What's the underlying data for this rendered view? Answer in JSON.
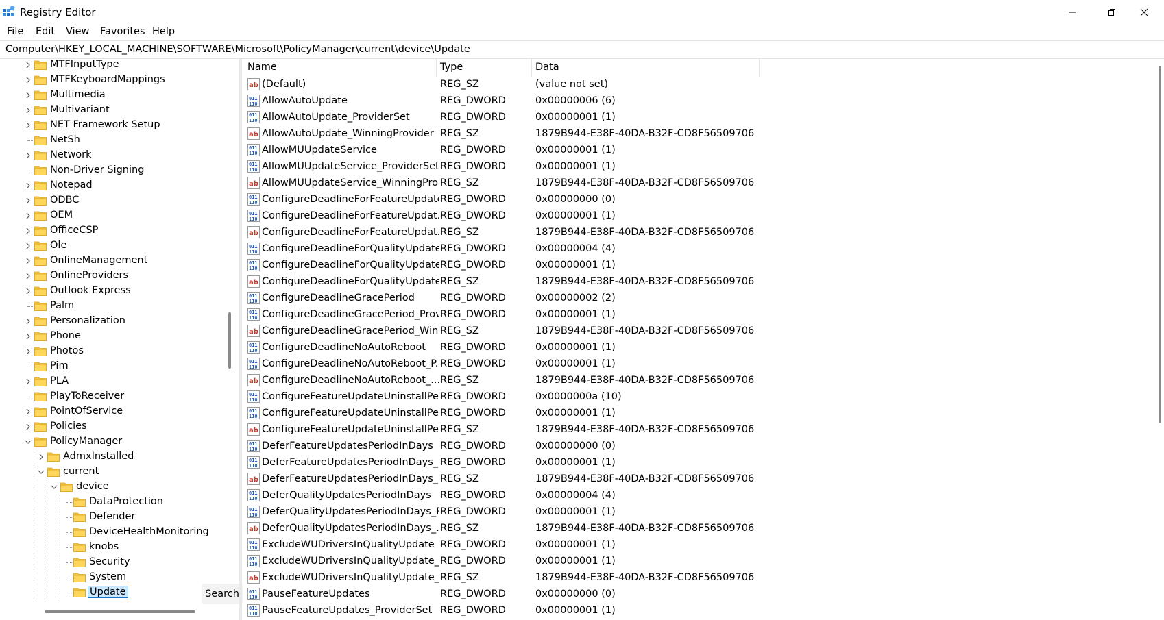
{
  "window": {
    "title": "Registry Editor"
  },
  "menu": [
    "File",
    "Edit",
    "View",
    "Favorites",
    "Help"
  ],
  "address": "Computer\\HKEY_LOCAL_MACHINE\\SOFTWARE\\Microsoft\\PolicyManager\\current\\device\\Update",
  "tree": [
    {
      "label": "MTFInputType",
      "level": 0,
      "expand": "collapsed"
    },
    {
      "label": "MTFKeyboardMappings",
      "level": 0,
      "expand": "collapsed"
    },
    {
      "label": "Multimedia",
      "level": 0,
      "expand": "collapsed"
    },
    {
      "label": "Multivariant",
      "level": 0,
      "expand": "collapsed"
    },
    {
      "label": "NET Framework Setup",
      "level": 0,
      "expand": "collapsed"
    },
    {
      "label": "NetSh",
      "level": 0,
      "expand": "none"
    },
    {
      "label": "Network",
      "level": 0,
      "expand": "collapsed"
    },
    {
      "label": "Non-Driver Signing",
      "level": 0,
      "expand": "none"
    },
    {
      "label": "Notepad",
      "level": 0,
      "expand": "collapsed"
    },
    {
      "label": "ODBC",
      "level": 0,
      "expand": "collapsed"
    },
    {
      "label": "OEM",
      "level": 0,
      "expand": "collapsed"
    },
    {
      "label": "OfficeCSP",
      "level": 0,
      "expand": "collapsed"
    },
    {
      "label": "Ole",
      "level": 0,
      "expand": "collapsed"
    },
    {
      "label": "OnlineManagement",
      "level": 0,
      "expand": "collapsed"
    },
    {
      "label": "OnlineProviders",
      "level": 0,
      "expand": "collapsed"
    },
    {
      "label": "Outlook Express",
      "level": 0,
      "expand": "collapsed"
    },
    {
      "label": "Palm",
      "level": 0,
      "expand": "none"
    },
    {
      "label": "Personalization",
      "level": 0,
      "expand": "collapsed"
    },
    {
      "label": "Phone",
      "level": 0,
      "expand": "collapsed"
    },
    {
      "label": "Photos",
      "level": 0,
      "expand": "collapsed"
    },
    {
      "label": "Pim",
      "level": 0,
      "expand": "none"
    },
    {
      "label": "PLA",
      "level": 0,
      "expand": "collapsed"
    },
    {
      "label": "PlayToReceiver",
      "level": 0,
      "expand": "none"
    },
    {
      "label": "PointOfService",
      "level": 0,
      "expand": "collapsed"
    },
    {
      "label": "Policies",
      "level": 0,
      "expand": "collapsed"
    },
    {
      "label": "PolicyManager",
      "level": 0,
      "expand": "expanded"
    },
    {
      "label": "AdmxInstalled",
      "level": 1,
      "expand": "collapsed"
    },
    {
      "label": "current",
      "level": 1,
      "expand": "expanded"
    },
    {
      "label": "device",
      "level": 2,
      "expand": "expanded"
    },
    {
      "label": "DataProtection",
      "level": 3,
      "expand": "none"
    },
    {
      "label": "Defender",
      "level": 3,
      "expand": "none"
    },
    {
      "label": "DeviceHealthMonitoring",
      "level": 3,
      "expand": "none"
    },
    {
      "label": "knobs",
      "level": 3,
      "expand": "none"
    },
    {
      "label": "Security",
      "level": 3,
      "expand": "none"
    },
    {
      "label": "System",
      "level": 3,
      "expand": "none"
    },
    {
      "label": "Update",
      "level": 3,
      "expand": "none",
      "selected": true
    }
  ],
  "search_label": "Search",
  "columns": {
    "name": "Name",
    "type": "Type",
    "data": "Data"
  },
  "values": [
    {
      "icon": "ab",
      "name": "(Default)",
      "type": "REG_SZ",
      "data": "(value not set)"
    },
    {
      "icon": "bin",
      "name": "AllowAutoUpdate",
      "type": "REG_DWORD",
      "data": "0x00000006 (6)"
    },
    {
      "icon": "bin",
      "name": "AllowAutoUpdate_ProviderSet",
      "type": "REG_DWORD",
      "data": "0x00000001 (1)"
    },
    {
      "icon": "ab",
      "name": "AllowAutoUpdate_WinningProvider",
      "type": "REG_SZ",
      "data": "1879B944-E38F-40DA-B32F-CD8F56509706"
    },
    {
      "icon": "bin",
      "name": "AllowMUUpdateService",
      "type": "REG_DWORD",
      "data": "0x00000001 (1)"
    },
    {
      "icon": "bin",
      "name": "AllowMUUpdateService_ProviderSet",
      "type": "REG_DWORD",
      "data": "0x00000001 (1)"
    },
    {
      "icon": "ab",
      "name": "AllowMUUpdateService_WinningPro...",
      "type": "REG_SZ",
      "data": "1879B944-E38F-40DA-B32F-CD8F56509706"
    },
    {
      "icon": "bin",
      "name": "ConfigureDeadlineForFeatureUpdates",
      "type": "REG_DWORD",
      "data": "0x00000000 (0)"
    },
    {
      "icon": "bin",
      "name": "ConfigureDeadlineForFeatureUpdat...",
      "type": "REG_DWORD",
      "data": "0x00000001 (1)"
    },
    {
      "icon": "ab",
      "name": "ConfigureDeadlineForFeatureUpdat...",
      "type": "REG_SZ",
      "data": "1879B944-E38F-40DA-B32F-CD8F56509706"
    },
    {
      "icon": "bin",
      "name": "ConfigureDeadlineForQualityUpdates",
      "type": "REG_DWORD",
      "data": "0x00000004 (4)"
    },
    {
      "icon": "bin",
      "name": "ConfigureDeadlineForQualityUpdate...",
      "type": "REG_DWORD",
      "data": "0x00000001 (1)"
    },
    {
      "icon": "ab",
      "name": "ConfigureDeadlineForQualityUpdate...",
      "type": "REG_SZ",
      "data": "1879B944-E38F-40DA-B32F-CD8F56509706"
    },
    {
      "icon": "bin",
      "name": "ConfigureDeadlineGracePeriod",
      "type": "REG_DWORD",
      "data": "0x00000002 (2)"
    },
    {
      "icon": "bin",
      "name": "ConfigureDeadlineGracePeriod_Prov...",
      "type": "REG_DWORD",
      "data": "0x00000001 (1)"
    },
    {
      "icon": "ab",
      "name": "ConfigureDeadlineGracePeriod_Win...",
      "type": "REG_SZ",
      "data": "1879B944-E38F-40DA-B32F-CD8F56509706"
    },
    {
      "icon": "bin",
      "name": "ConfigureDeadlineNoAutoReboot",
      "type": "REG_DWORD",
      "data": "0x00000001 (1)"
    },
    {
      "icon": "bin",
      "name": "ConfigureDeadlineNoAutoReboot_P...",
      "type": "REG_DWORD",
      "data": "0x00000001 (1)"
    },
    {
      "icon": "ab",
      "name": "ConfigureDeadlineNoAutoReboot_...",
      "type": "REG_SZ",
      "data": "1879B944-E38F-40DA-B32F-CD8F56509706"
    },
    {
      "icon": "bin",
      "name": "ConfigureFeatureUpdateUninstallPer...",
      "type": "REG_DWORD",
      "data": "0x0000000a (10)"
    },
    {
      "icon": "bin",
      "name": "ConfigureFeatureUpdateUninstallPer...",
      "type": "REG_DWORD",
      "data": "0x00000001 (1)"
    },
    {
      "icon": "ab",
      "name": "ConfigureFeatureUpdateUninstallPer...",
      "type": "REG_SZ",
      "data": "1879B944-E38F-40DA-B32F-CD8F56509706"
    },
    {
      "icon": "bin",
      "name": "DeferFeatureUpdatesPeriodInDays",
      "type": "REG_DWORD",
      "data": "0x00000000 (0)"
    },
    {
      "icon": "bin",
      "name": "DeferFeatureUpdatesPeriodInDays_P...",
      "type": "REG_DWORD",
      "data": "0x00000001 (1)"
    },
    {
      "icon": "ab",
      "name": "DeferFeatureUpdatesPeriodInDays_...",
      "type": "REG_SZ",
      "data": "1879B944-E38F-40DA-B32F-CD8F56509706"
    },
    {
      "icon": "bin",
      "name": "DeferQualityUpdatesPeriodInDays",
      "type": "REG_DWORD",
      "data": "0x00000004 (4)"
    },
    {
      "icon": "bin",
      "name": "DeferQualityUpdatesPeriodInDays_P...",
      "type": "REG_DWORD",
      "data": "0x00000001 (1)"
    },
    {
      "icon": "ab",
      "name": "DeferQualityUpdatesPeriodInDays_...",
      "type": "REG_SZ",
      "data": "1879B944-E38F-40DA-B32F-CD8F56509706"
    },
    {
      "icon": "bin",
      "name": "ExcludeWUDriversInQualityUpdate",
      "type": "REG_DWORD",
      "data": "0x00000001 (1)"
    },
    {
      "icon": "bin",
      "name": "ExcludeWUDriversInQualityUpdate_P...",
      "type": "REG_DWORD",
      "data": "0x00000001 (1)"
    },
    {
      "icon": "ab",
      "name": "ExcludeWUDriversInQualityUpdate_...",
      "type": "REG_SZ",
      "data": "1879B944-E38F-40DA-B32F-CD8F56509706"
    },
    {
      "icon": "bin",
      "name": "PauseFeatureUpdates",
      "type": "REG_DWORD",
      "data": "0x00000000 (0)"
    },
    {
      "icon": "bin",
      "name": "PauseFeatureUpdates_ProviderSet",
      "type": "REG_DWORD",
      "data": "0x00000001 (1)"
    }
  ]
}
